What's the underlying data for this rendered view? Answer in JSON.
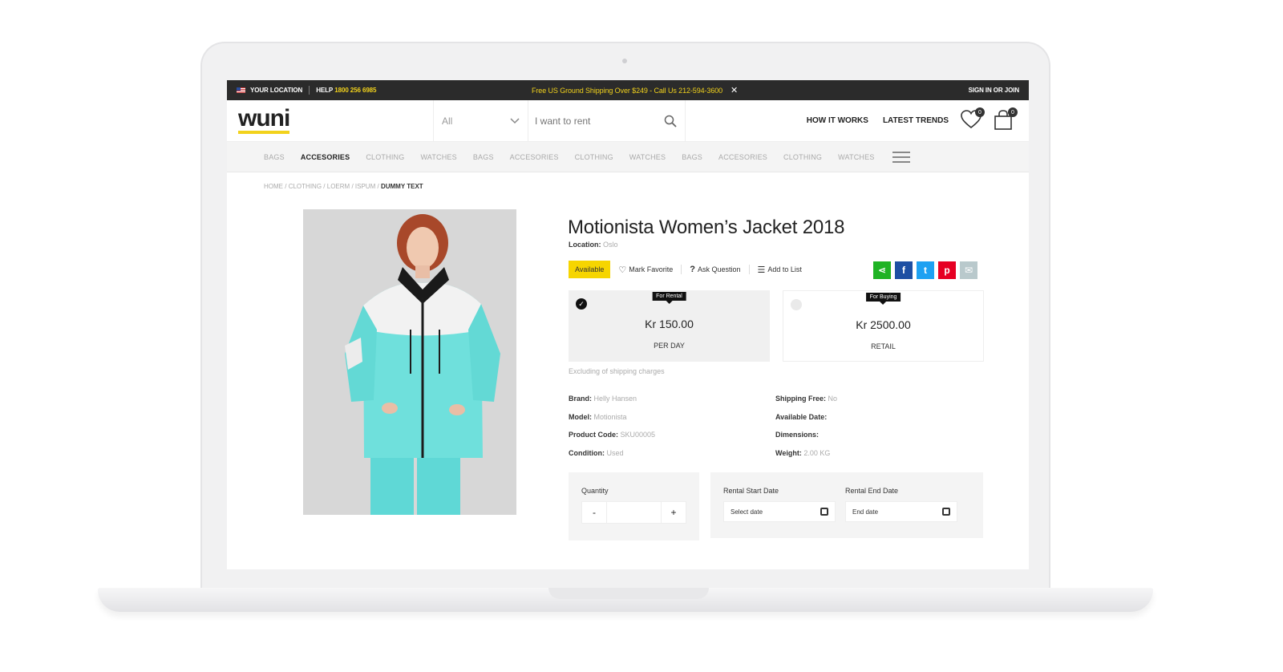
{
  "topbar": {
    "location": "YOUR LOCATION",
    "help_label": "HELP",
    "help_phone": "1800 256 6985",
    "promo": "Free US Ground Shipping Over $249 - Call Us 212-594-3600",
    "close": "✕",
    "signin": "SIGN IN OR JOIN"
  },
  "header": {
    "logo": "wuni",
    "category_value": "All",
    "search_placeholder": "I want to rent",
    "links": [
      "HOW IT WORKS",
      "LATEST TRENDS"
    ],
    "wishlist_count": "0",
    "cart_count": "0"
  },
  "catnav": [
    "BAGS",
    "ACCESORIES",
    "CLOTHING",
    "WATCHES",
    "BAGS",
    "ACCESORIES",
    "CLOTHING",
    "WATCHES",
    "BAGS",
    "ACCESORIES",
    "CLOTHING",
    "WATCHES"
  ],
  "breadcrumb": {
    "items": [
      "HOME",
      "CLOTHING",
      "LOERM",
      "ISPUM"
    ],
    "current": "DUMMY TEXT",
    "separator": "/"
  },
  "product": {
    "title": "Motionista Women’s Jacket 2018",
    "location_label": "Location:",
    "location_value": "Oslo",
    "availability": "Available",
    "mark_favorite": "Mark Favorite",
    "ask_question": "Ask Question",
    "add_to_list": "Add to List",
    "rental": {
      "tag": "For Rental",
      "price": "Kr 150.00",
      "period": "PER DAY"
    },
    "buying": {
      "tag": "For Buying",
      "price": "Kr 2500.00",
      "period": "RETAIL"
    },
    "shipping_note": "Excluding of shipping charges",
    "specs_left": [
      {
        "label": "Brand:",
        "value": "Helly Hansen"
      },
      {
        "label": "Model:",
        "value": "Motionista"
      },
      {
        "label": "Product Code:",
        "value": "SKU00005"
      },
      {
        "label": "Condition:",
        "value": "Used"
      }
    ],
    "specs_right": [
      {
        "label": "Shipping Free:",
        "value": "No"
      },
      {
        "label": "Available Date:",
        "value": ""
      },
      {
        "label": "Dimensions:",
        "value": ""
      },
      {
        "label": "Weight:",
        "value": "2.00 KG"
      }
    ],
    "quantity_label": "Quantity",
    "qty_minus": "-",
    "qty_plus": "+",
    "rental_start_label": "Rental Start Date",
    "rental_start_placeholder": "Select date",
    "rental_end_label": "Rental End Date",
    "rental_end_placeholder": "End date"
  },
  "social_icons": [
    "share-icon",
    "facebook-icon",
    "twitter-icon",
    "pinterest-icon",
    "email-icon"
  ],
  "colors": {
    "accent_yellow": "#f2d21c",
    "topbar": "#2b2b2b",
    "share": "#1fb324",
    "facebook": "#1d4fa3",
    "twitter": "#1da1f2",
    "pinterest": "#e60023",
    "email": "#b9c9cc"
  }
}
